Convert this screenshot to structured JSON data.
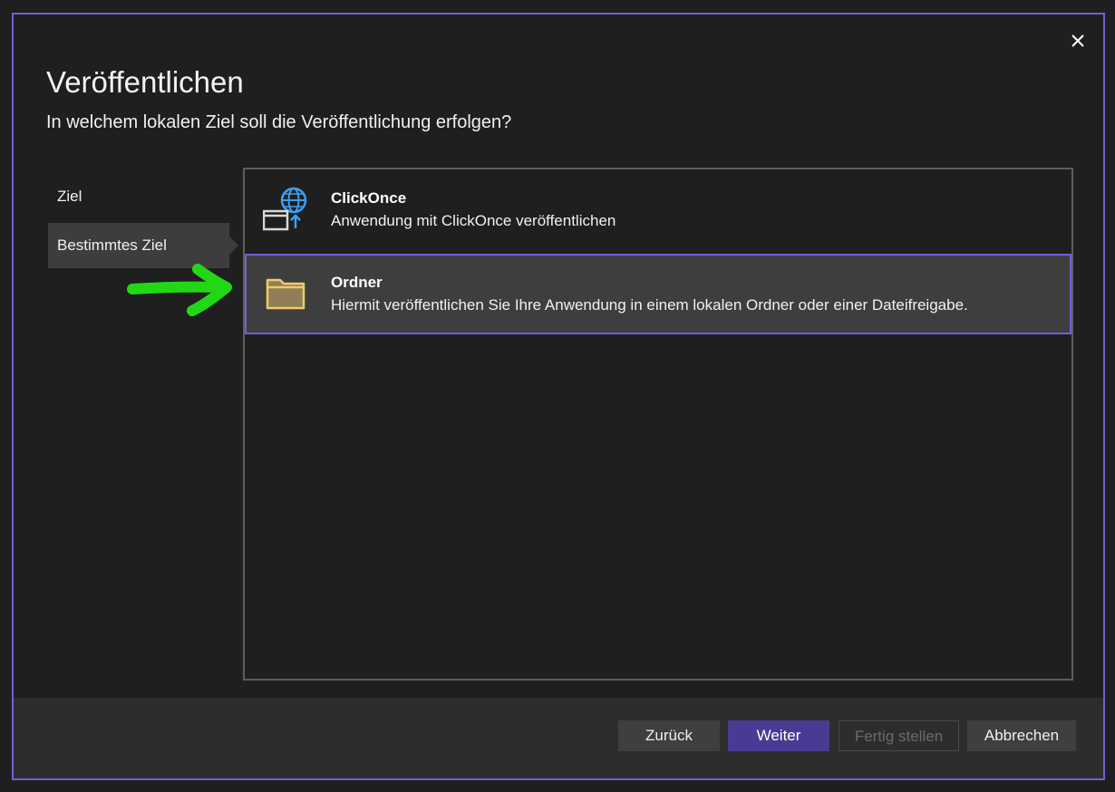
{
  "dialog": {
    "title": "Veröffentlichen",
    "subtitle": "In welchem lokalen Ziel soll die Veröffentlichung erfolgen?",
    "close_icon": "close-icon"
  },
  "steps": [
    {
      "label": "Ziel",
      "active": false
    },
    {
      "label": "Bestimmtes Ziel",
      "active": true
    }
  ],
  "targets": [
    {
      "title": "ClickOnce",
      "description": "Anwendung mit ClickOnce veröffentlichen",
      "icon": "clickonce-globe-icon",
      "selected": false
    },
    {
      "title": "Ordner",
      "description": "Hiermit veröffentlichen Sie Ihre Anwendung in einem lokalen Ordner oder einer Dateifreigabe.",
      "icon": "folder-icon",
      "selected": true
    }
  ],
  "footer": {
    "back_label": "Zurück",
    "next_label": "Weiter",
    "finish_label": "Fertig stellen",
    "cancel_label": "Abbrechen"
  },
  "annotation": {
    "icon": "green-arrow-icon",
    "color": "#22d816"
  },
  "colors": {
    "accent": "#7160d6",
    "primary_button": "#4b3a94",
    "background": "#1f1f1f"
  }
}
